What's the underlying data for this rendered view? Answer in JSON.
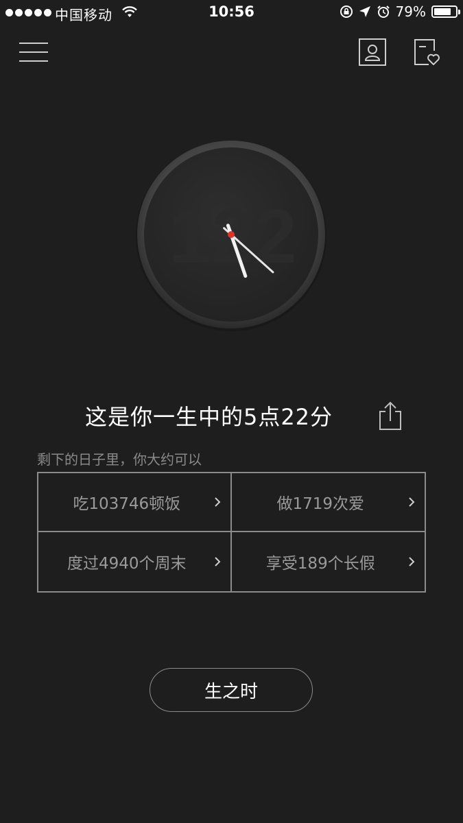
{
  "status_bar": {
    "carrier": "中国移动",
    "time": "10:56",
    "battery_percent_label": "79%",
    "battery_level": 0.79
  },
  "nav": {
    "menu_icon": "hamburger-menu-icon",
    "profile_icon": "user-profile-icon",
    "favorites_icon": "favorites-list-icon"
  },
  "clock": {
    "watermark": "122",
    "hour": 5,
    "minute": 22
  },
  "headline": {
    "text": "这是你一生中的5点22分",
    "share_icon": "share-icon"
  },
  "subtitle": "剩下的日子里，你大约可以",
  "stats": [
    {
      "label": "吃103746顿饭"
    },
    {
      "label": "做1719次爱"
    },
    {
      "label": "度过4940个周末"
    },
    {
      "label": "享受189个长假"
    }
  ],
  "primary_button": {
    "label": "生之时"
  },
  "colors": {
    "background": "#1e1e1e",
    "border": "#8c8c8c",
    "muted_text": "#9a9a9a",
    "accent_red": "#e0332a"
  }
}
